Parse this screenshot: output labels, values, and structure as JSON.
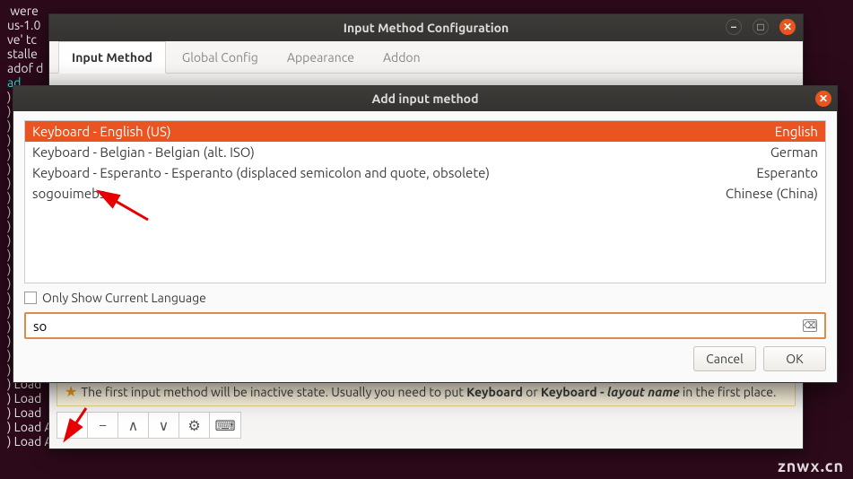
{
  "terminal": {
    "lines": [
      " were",
      "us-1.0",
      "ve' tc",
      "stalle",
      "adof d",
      ")",
      ")",
      ")",
      ")",
      ")",
      ")",
      ")",
      ")",
      ")",
      ")",
      ")",
      ")",
      ")",
      ")",
      ")",
      ")",
      ")",
      ")",
      ")",
      ")",
      ")",
      ") Load",
      ") Load",
      ") Load",
      ") Load Addon Config File:fcitx-clipboard.conf",
      ") Load Addon Config File:fcitx-freedesktop-notify.conf"
    ],
    "cyan_prefix": "ad"
  },
  "config_window": {
    "title": "Input Method Configuration",
    "tabs": [
      "Input Method",
      "Global Config",
      "Appearance",
      "Addon"
    ],
    "active_tab": 0,
    "hint_pre": "The first input method will be inactive state. Usually you need to put ",
    "hint_b1": "Keyboard",
    "hint_mid": " or ",
    "hint_b2": "Keyboard - ",
    "hint_i": "layout name",
    "hint_post": " in the first place.",
    "toolbar_icons": [
      "+",
      "−",
      "∧",
      "∨",
      "⚙",
      "⌨"
    ]
  },
  "dialog": {
    "title": "Add input method",
    "items": [
      {
        "name": "Keyboard - English (US)",
        "lang": "English",
        "selected": true
      },
      {
        "name": "Keyboard - Belgian - Belgian (alt. ISO)",
        "lang": "German",
        "selected": false
      },
      {
        "name": "Keyboard - Esperanto - Esperanto (displaced semicolon and quote, obsolete)",
        "lang": "Esperanto",
        "selected": false
      },
      {
        "name": "sogouimebs",
        "lang": "Chinese (China)",
        "selected": false
      }
    ],
    "checkbox_label": "Only Show Current Language",
    "search_value": "so",
    "buttons": {
      "cancel": "Cancel",
      "ok": "OK"
    }
  },
  "watermark": "znwx.cn"
}
